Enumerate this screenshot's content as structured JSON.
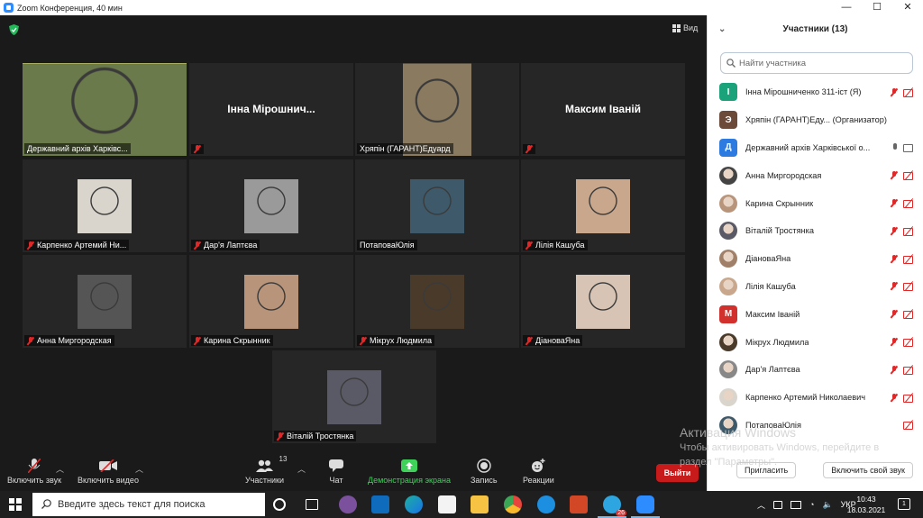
{
  "window": {
    "title": "Zoom Конференция, 40 мин",
    "controls": [
      "—",
      "☐",
      "✕"
    ]
  },
  "meeting": {
    "view_label": "Вид",
    "tiles": [
      {
        "name": "Державний архів Харківс...",
        "kind": "video",
        "color": "#6a7a4a",
        "mic": "on",
        "active": true
      },
      {
        "name": "Інна Мірошнич...",
        "big_name": "Інна Мірошнич...",
        "kind": "name",
        "mic": "off"
      },
      {
        "name": "Хряпін (ГАРАНТ)Едуард",
        "kind": "video",
        "color": "#8a7a60",
        "mic": "on"
      },
      {
        "name": "Максим Іваній",
        "big_name": "Максим Іваній",
        "kind": "name",
        "mic": "off"
      },
      {
        "name": "Карпенко Артемий Ни...",
        "kind": "photo",
        "color": "#d9d4cc",
        "mic": "off"
      },
      {
        "name": "Дар'я Лаптєва",
        "kind": "photo",
        "color": "#9a9a9a",
        "mic": "off"
      },
      {
        "name": "ПотаповаЮлія",
        "kind": "photo",
        "color": "#3e5a6a",
        "mic": "on"
      },
      {
        "name": "Лілія Кашуба",
        "kind": "photo",
        "color": "#c9a78c",
        "mic": "off"
      },
      {
        "name": "Анна Миргородская",
        "kind": "photo",
        "color": "#555",
        "mic": "off"
      },
      {
        "name": "Карина Скрынник",
        "kind": "photo",
        "color": "#b8957a",
        "mic": "off"
      },
      {
        "name": "Мікрух Людмила",
        "kind": "photo",
        "color": "#4a3a2a",
        "mic": "off"
      },
      {
        "name": "ДіановаЯна",
        "kind": "photo",
        "color": "#d8c4b4",
        "mic": "off"
      },
      {
        "name": "Віталій Тростянка",
        "kind": "photo",
        "color": "#5a5a66",
        "mic": "off"
      }
    ]
  },
  "toolbar": {
    "unmute": "Включить звук",
    "start_video": "Включить видео",
    "participants": "Участники",
    "participants_count": "13",
    "chat": "Чат",
    "share": "Демонстрация экрана",
    "record": "Запись",
    "reactions": "Реакции",
    "leave": "Выйти"
  },
  "panel": {
    "title": "Участники (13)",
    "search_placeholder": "Найти участника",
    "invite": "Пригласить",
    "unmute_self": "Включить свой звук",
    "participants": [
      {
        "name": "Інна Мірошниченко 311-іст (Я)",
        "avatar_letter": "І",
        "avatar_color": "#1aa37a",
        "mic": "off",
        "cam": "off"
      },
      {
        "name": "Хряпін (ГАРАНТ)Еду... (Организатор)",
        "avatar_letter": "Э",
        "avatar_color": "#6b4a3a",
        "mic": "none",
        "cam": "none"
      },
      {
        "name": "Державний архів Харківської о...",
        "avatar_letter": "Д",
        "avatar_color": "#2d7be0",
        "mic": "on",
        "cam": "on"
      },
      {
        "name": "Анна Миргородская",
        "avatar_letter": "",
        "avatar_color": "#444",
        "mic": "off",
        "cam": "off"
      },
      {
        "name": "Карина Скрынник",
        "avatar_letter": "",
        "avatar_color": "#b8957a",
        "mic": "off",
        "cam": "off"
      },
      {
        "name": "Віталій Тростянка",
        "avatar_letter": "",
        "avatar_color": "#5a5a66",
        "mic": "off",
        "cam": "off"
      },
      {
        "name": "ДіановаЯна",
        "avatar_letter": "",
        "avatar_color": "#a08068",
        "mic": "off",
        "cam": "off"
      },
      {
        "name": "Лілія Кашуба",
        "avatar_letter": "",
        "avatar_color": "#c9a78c",
        "mic": "off",
        "cam": "off"
      },
      {
        "name": "Максим Іваній",
        "avatar_letter": "М",
        "avatar_color": "#d2302c",
        "mic": "off",
        "cam": "off"
      },
      {
        "name": "Мікрух Людмила",
        "avatar_letter": "",
        "avatar_color": "#4a3a2a",
        "mic": "off",
        "cam": "off"
      },
      {
        "name": "Дар'я Лаптєва",
        "avatar_letter": "",
        "avatar_color": "#888",
        "mic": "off",
        "cam": "off"
      },
      {
        "name": "Карпенко Артемий Николаевич",
        "avatar_letter": "",
        "avatar_color": "#d9d4cc",
        "mic": "off",
        "cam": "off"
      },
      {
        "name": "ПотаповаЮлія",
        "avatar_letter": "",
        "avatar_color": "#3e5a6a",
        "mic": "none",
        "cam": "off"
      }
    ]
  },
  "watermark": {
    "line1": "Активация Windows",
    "line2": "Чтобы активировать Windows, перейдите в",
    "line3": "раздел \"Параметры\"."
  },
  "taskbar": {
    "search_placeholder": "Введите здесь текст для поиска",
    "lang": "УКР",
    "time": "10:43",
    "date": "18.03.2021",
    "telegram_badge": "26",
    "notif_count": "1"
  }
}
